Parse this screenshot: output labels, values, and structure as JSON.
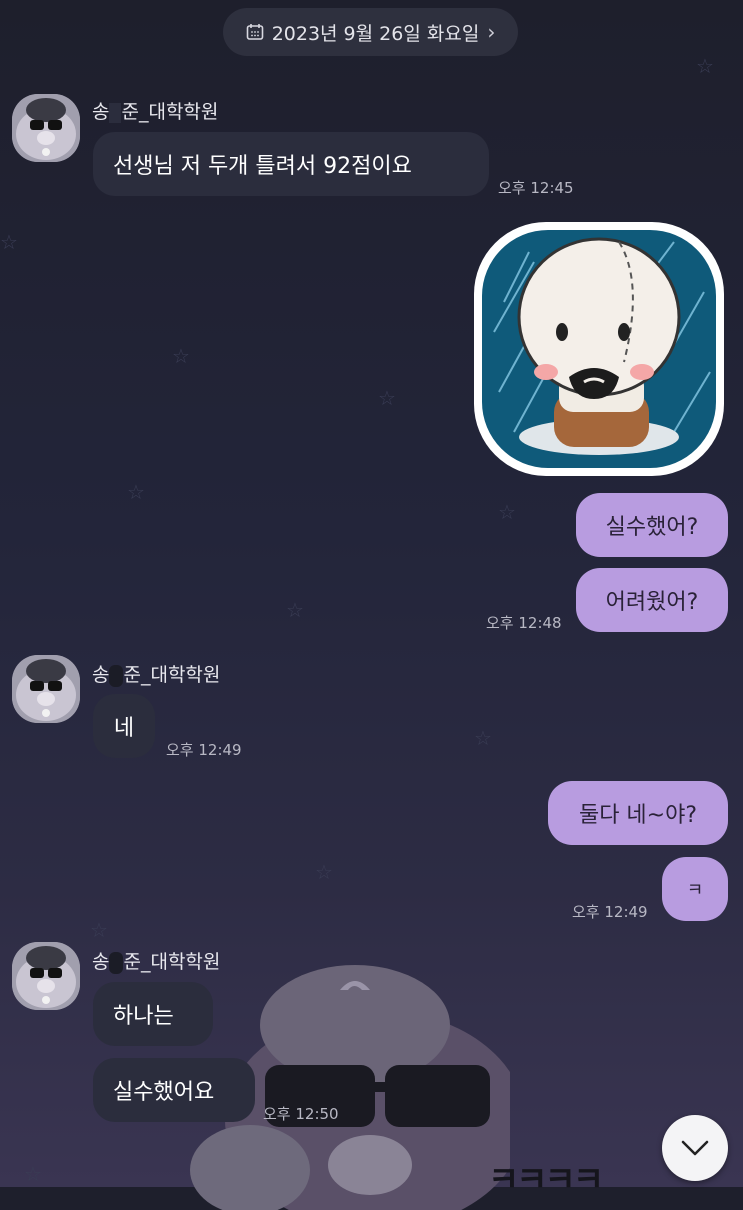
{
  "date_divider": {
    "label": "2023년 9월 26일 화요일",
    "icon": "calendar-icon",
    "chevron": "chevron-right-icon"
  },
  "sender_name_1": "송",
  "sender_name_1b": "준_대학학원",
  "sender_name_2": "송",
  "sender_name_2b": "준_대학학원",
  "sender_name_3": "송",
  "sender_name_3b": "준_대학학원",
  "messages": {
    "m1": "선생님 저 두개 틀려서 92점이요",
    "t1": "오후 12:45",
    "m2": "실수했어?",
    "m3": "어려웠어?",
    "t2": "오후 12:48",
    "m4": "네",
    "t3": "오후 12:49",
    "m5": "둘다 네~야?",
    "m6": "ㅋ",
    "t4": "오후 12:49",
    "m7": "하나는",
    "m8": "실수했어요",
    "t5": "오후 12:50"
  },
  "background_text": "ㅋㅋㅋㅋ",
  "colors": {
    "outgoing_bubble": "#b89ce0",
    "incoming_bubble": "#2b2d3d",
    "background": "#1e1f2c"
  },
  "scroll_button_icon": "chevron-down-icon"
}
